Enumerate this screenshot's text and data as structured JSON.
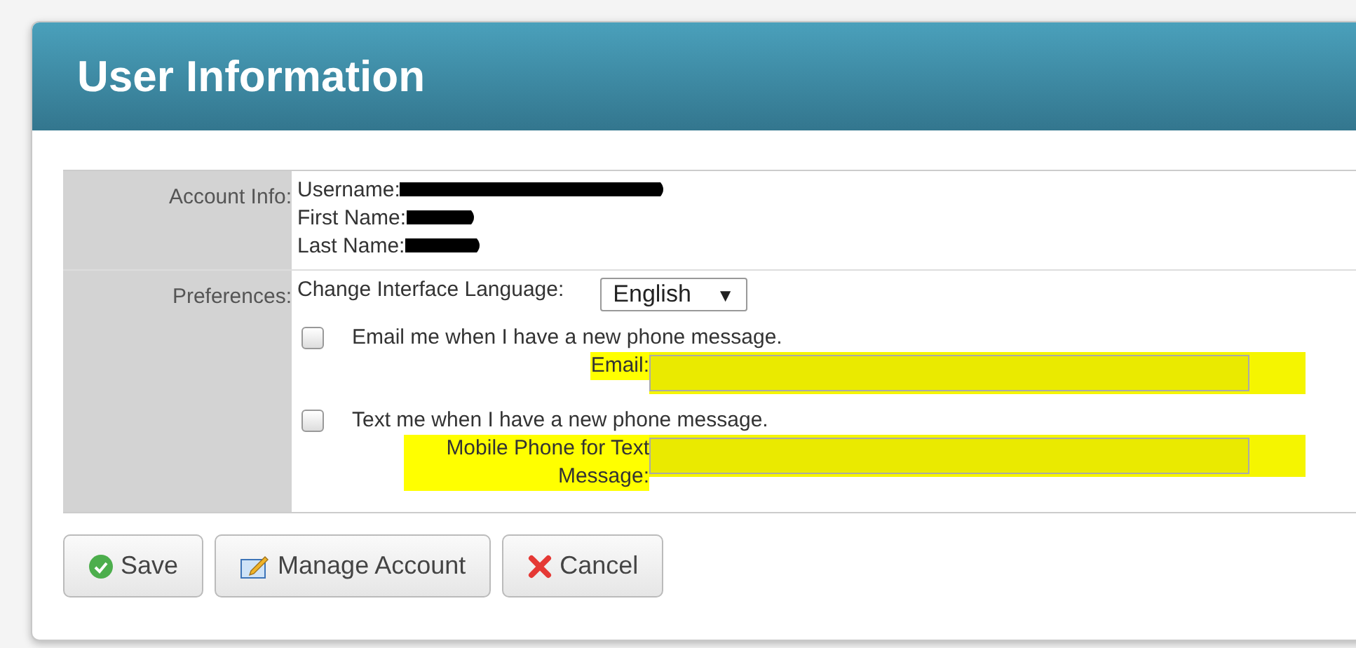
{
  "dialog": {
    "title": "User Information"
  },
  "account": {
    "label": "Account Info:",
    "fields": [
      {
        "label": "Username:"
      },
      {
        "label": "First Name:"
      },
      {
        "label": "Last Name:"
      }
    ]
  },
  "preferences": {
    "label": "Preferences:",
    "language_label": "Change Interface Language:",
    "language": "English",
    "arrow": "▼",
    "notifications": [
      {
        "label": "Email me when I have a new phone message.",
        "checked": false,
        "field_label": "Email:"
      },
      {
        "label": "Text me when I have a new phone message.",
        "checked": false,
        "field_label": "Mobile Phone for Text Message:"
      }
    ]
  },
  "buttons": [
    {
      "label": "Save",
      "kind": "save"
    },
    {
      "label": "Manage Account",
      "kind": "manage"
    },
    {
      "label": "Cancel",
      "kind": "cancel"
    }
  ]
}
